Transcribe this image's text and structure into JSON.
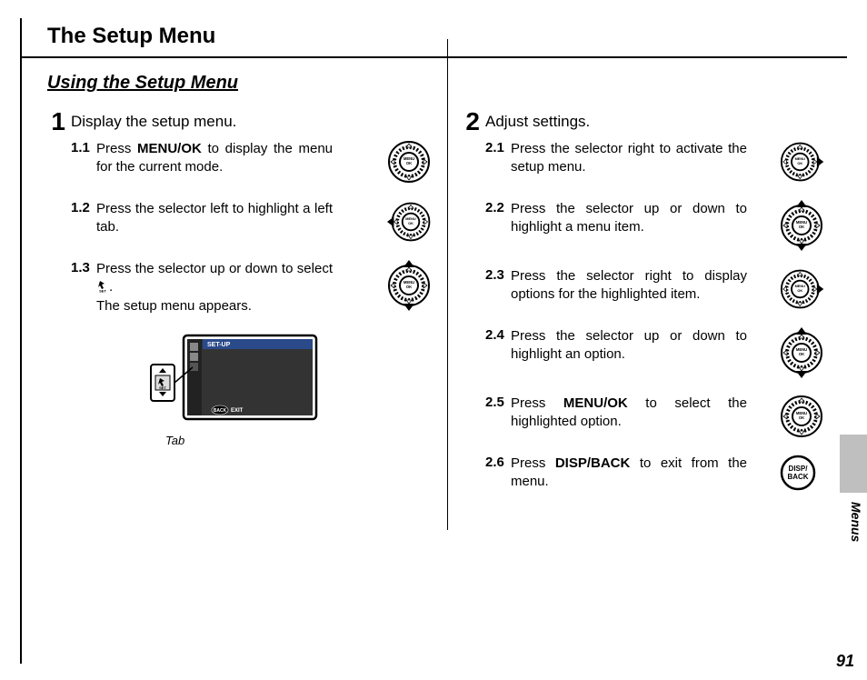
{
  "title": "The Setup Menu",
  "subtitle": "Using the Setup Menu",
  "left": {
    "num": "1",
    "head": "Display the setup menu.",
    "s1": {
      "num": "1.1",
      "pre": "Press ",
      "strong": "MENU/OK",
      "post": " to display the menu for the current mode."
    },
    "s2": {
      "num": "1.2",
      "txt": "Press the selector left to high­light a left tab."
    },
    "s3": {
      "num": "1.3",
      "txt_a": "Press the selector up or down to select ",
      "set": "SET",
      "txt_b": ".",
      "txt_c": "The setup menu appears."
    },
    "screen_label": "SET-UP",
    "screen_exit": "EXIT",
    "screen_back": "BACK",
    "tab_caption": "Tab"
  },
  "right": {
    "num": "2",
    "head": "Adjust settings.",
    "s1": {
      "num": "2.1",
      "txt": "Press the selector right to acti­vate the setup menu."
    },
    "s2": {
      "num": "2.2",
      "txt": "Press the selector up or down to highlight a menu item."
    },
    "s3": {
      "num": "2.3",
      "txt": "Press the selector right to dis­play options for the highlighted item."
    },
    "s4": {
      "num": "2.4",
      "txt": "Press the selector up or down to highlight an option."
    },
    "s5": {
      "num": "2.5",
      "pre": "Press ",
      "strong": "MENU/OK",
      "post": " to select the highlighted option."
    },
    "s6": {
      "num": "2.6",
      "pre": "Press ",
      "strong": "DISP/BACK",
      "post": " to exit from the menu."
    },
    "disp_back": "DISP/\nBACK"
  },
  "side_label": "Menus",
  "page_number": "91"
}
